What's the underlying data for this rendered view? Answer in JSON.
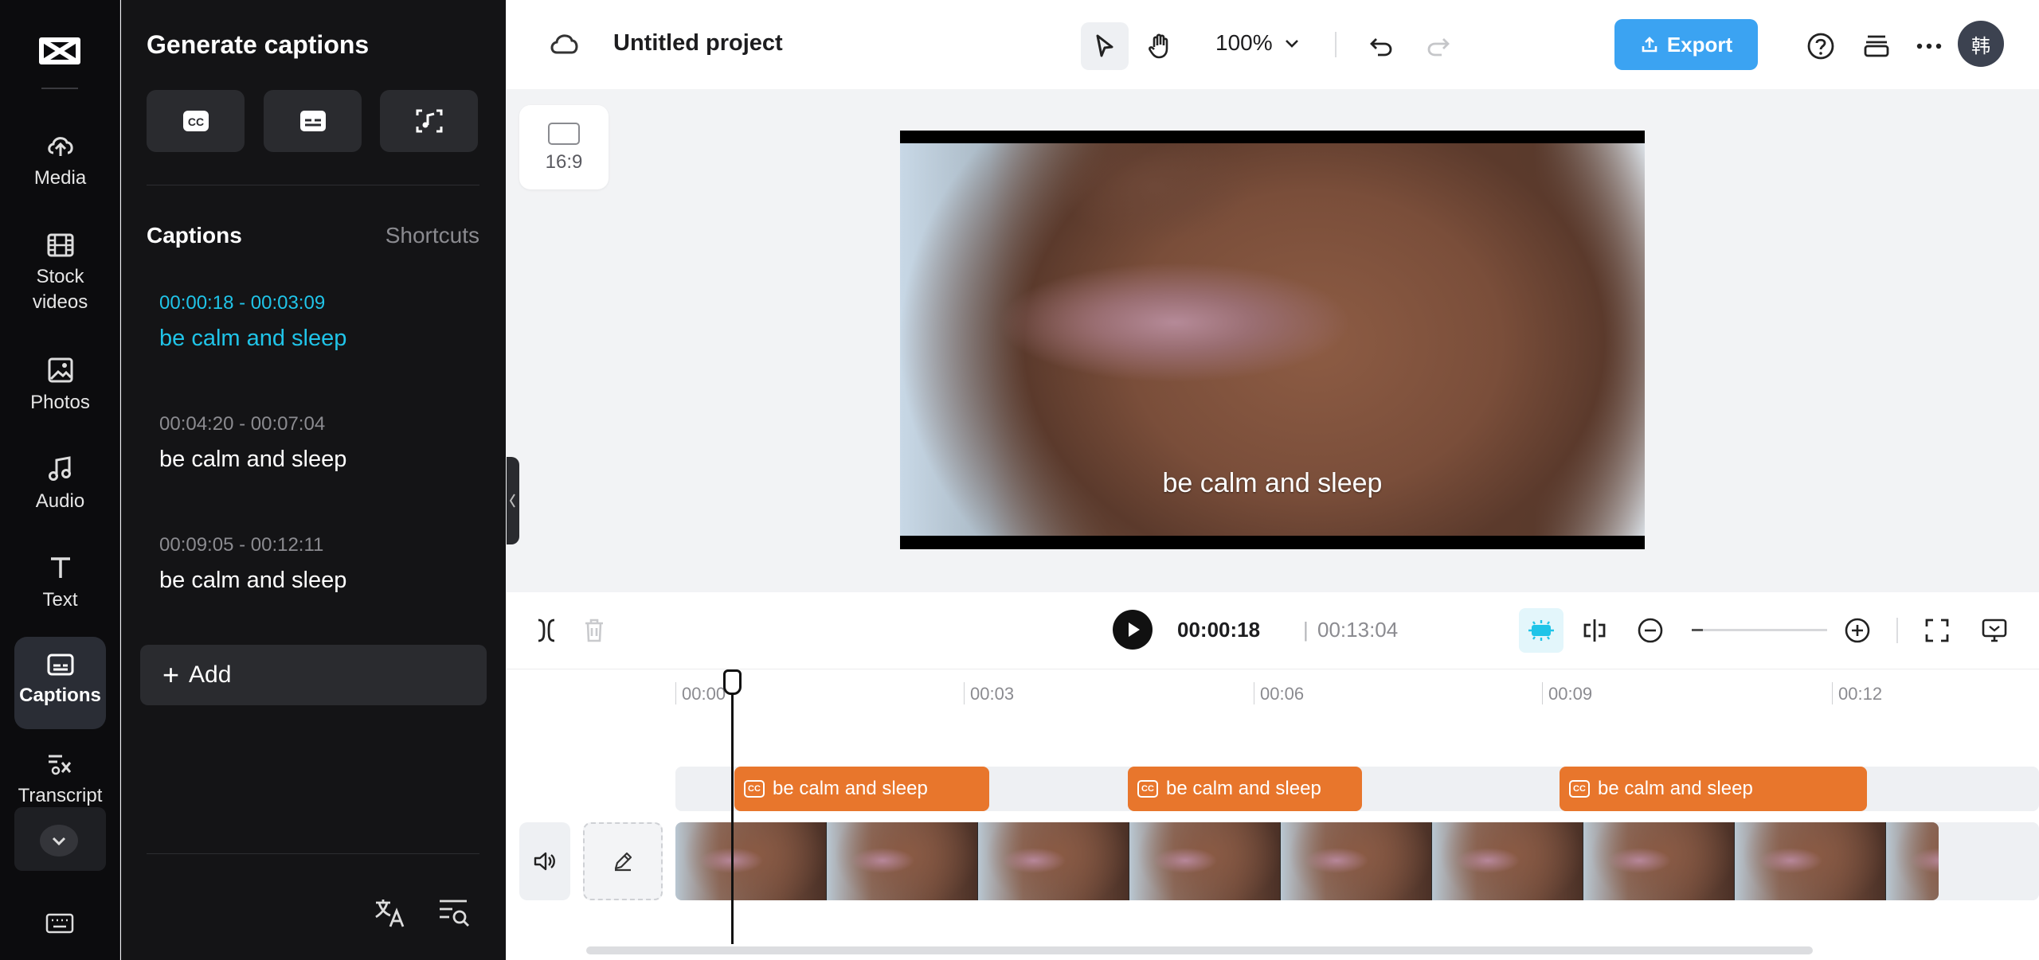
{
  "rail": {
    "items": [
      {
        "label": "Media",
        "icon": "cloud-upload-icon"
      },
      {
        "label": "Stock\nvideos",
        "icon": "film-icon"
      },
      {
        "label": "Photos",
        "icon": "image-icon"
      },
      {
        "label": "Audio",
        "icon": "music-note-icon"
      },
      {
        "label": "Text",
        "icon": "text-T-icon"
      },
      {
        "label": "Captions",
        "icon": "captions-icon",
        "active": true
      },
      {
        "label": "Transcript",
        "icon": "transcript-icon"
      }
    ]
  },
  "panel": {
    "title": "Generate captions",
    "captions_heading": "Captions",
    "shortcuts_label": "Shortcuts",
    "captions": [
      {
        "time": "00:00:18 - 00:03:09",
        "text": "be calm and sleep",
        "active": true
      },
      {
        "time": "00:04:20 - 00:07:04",
        "text": "be calm and sleep"
      },
      {
        "time": "00:09:05 - 00:12:11",
        "text": "be calm and sleep"
      }
    ],
    "add_label": "Add",
    "accent": "#20c4e8"
  },
  "topbar": {
    "project_title": "Untitled project",
    "zoom": "100%",
    "export_label": "Export",
    "avatar_initial": "韩",
    "export_color": "#3ba3f2"
  },
  "aspect": {
    "label": "16:9"
  },
  "preview": {
    "subtitle": "be calm and sleep"
  },
  "playback": {
    "current_time": "00:00:18",
    "separator": "|",
    "duration": "00:13:04",
    "zoom_level": 0.08
  },
  "timeline": {
    "ruler": [
      "00:00",
      "00:03",
      "00:06",
      "00:09",
      "00:12"
    ],
    "clips": [
      {
        "text": "be calm and sleep"
      },
      {
        "text": "be calm and sleep"
      },
      {
        "text": "be calm and sleep"
      }
    ],
    "clip_color": "#e8762c"
  }
}
